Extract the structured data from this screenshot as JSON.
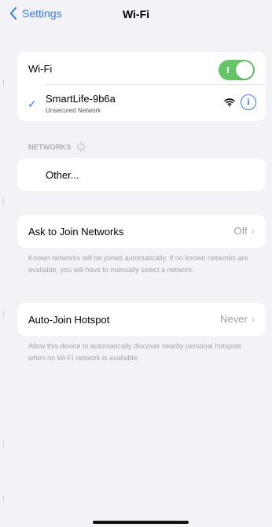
{
  "nav": {
    "back_label": "Settings",
    "title": "Wi-Fi"
  },
  "wifi": {
    "label": "Wi-Fi",
    "enabled": true,
    "connected_network": {
      "name": "SmartLife-9b6a",
      "subtitle": "Unsecured Network",
      "icons": [
        "checkmark-icon",
        "wifi-signal-icon",
        "info-icon"
      ]
    }
  },
  "networks": {
    "header": "NETWORKS",
    "other_label": "Other..."
  },
  "ask_to_join": {
    "label": "Ask to Join Networks",
    "value": "Off",
    "footnote": "Known networks will be joined automatically. If no known networks are available, you will have to manually select a network."
  },
  "auto_join_hotspot": {
    "label": "Auto-Join Hotspot",
    "value": "Never",
    "footnote": "Allow this device to automatically discover nearby personal hotspots when no Wi-Fi network is available."
  },
  "colors": {
    "accent": "#2f7cf6",
    "toggle_on": "#64c466",
    "background": "#f2f2f7",
    "card": "#ffffff"
  }
}
